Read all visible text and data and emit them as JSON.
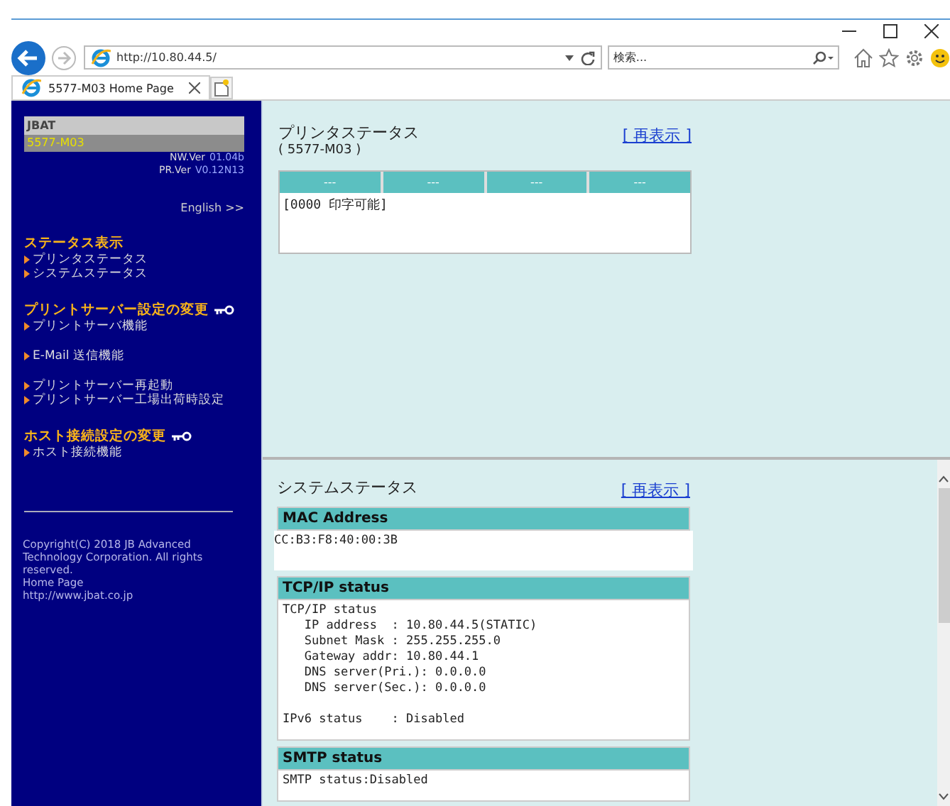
{
  "browser": {
    "address": "http://10.80.44.5/",
    "search_placeholder": "検索...",
    "tab_title": "5577-M03 Home Page"
  },
  "sidebar": {
    "brand": "JBAT",
    "model": "5577-M03",
    "versions": [
      {
        "label": "NW.Ver",
        "value": "01.04b"
      },
      {
        "label": "PR.Ver",
        "value": "V0.12N13"
      }
    ],
    "language_link": "English >>",
    "sections": [
      {
        "title": "ステータス表示",
        "locked": false,
        "groups": [
          [
            "プリンタステータス",
            "システムステータス"
          ]
        ]
      },
      {
        "title": "プリントサーバー設定の変更",
        "locked": true,
        "groups": [
          [
            "プリントサーバ機能"
          ],
          [
            "E-Mail 送信機能"
          ],
          [
            "プリントサーバー再起動",
            "プリントサーバー工場出荷時設定"
          ]
        ]
      },
      {
        "title": "ホスト接続設定の変更",
        "locked": true,
        "groups": [
          [
            "ホスト接続機能"
          ]
        ]
      }
    ],
    "copyright": "Copyright(C) 2018 JB Advanced Technology Corporation. All rights reserved.",
    "homepage_label": "Home Page",
    "homepage_url": "http://www.jbat.co.jp"
  },
  "printer_status": {
    "title": "プリンタステータス",
    "model": "( 5577-M03 )",
    "refresh": "[ 再表示 ]",
    "columns": [
      "---",
      "---",
      "---",
      "---"
    ],
    "message": "[0000  印字可能]"
  },
  "system_status": {
    "title": "システムステータス",
    "refresh": "[ 再表示 ]",
    "sections": [
      {
        "heading": "MAC Address",
        "kind": "plain",
        "paragraphs": [
          [
            "CC:B3:F8:40:00:3B"
          ]
        ]
      },
      {
        "heading": "TCP/IP status",
        "kind": "boxed",
        "paragraphs": [
          [
            "TCP/IP status",
            "   IP address  : 10.80.44.5(STATIC)",
            "   Subnet Mask : 255.255.255.0",
            "   Gateway addr: 10.80.44.1",
            "   DNS server(Pri.): 0.0.0.0",
            "   DNS server(Sec.): 0.0.0.0"
          ],
          [
            "IPv6 status    : Disabled"
          ]
        ]
      },
      {
        "heading": "SMTP status",
        "kind": "boxed",
        "paragraphs": [
          [
            "SMTP status:Disabled"
          ]
        ]
      }
    ]
  }
}
